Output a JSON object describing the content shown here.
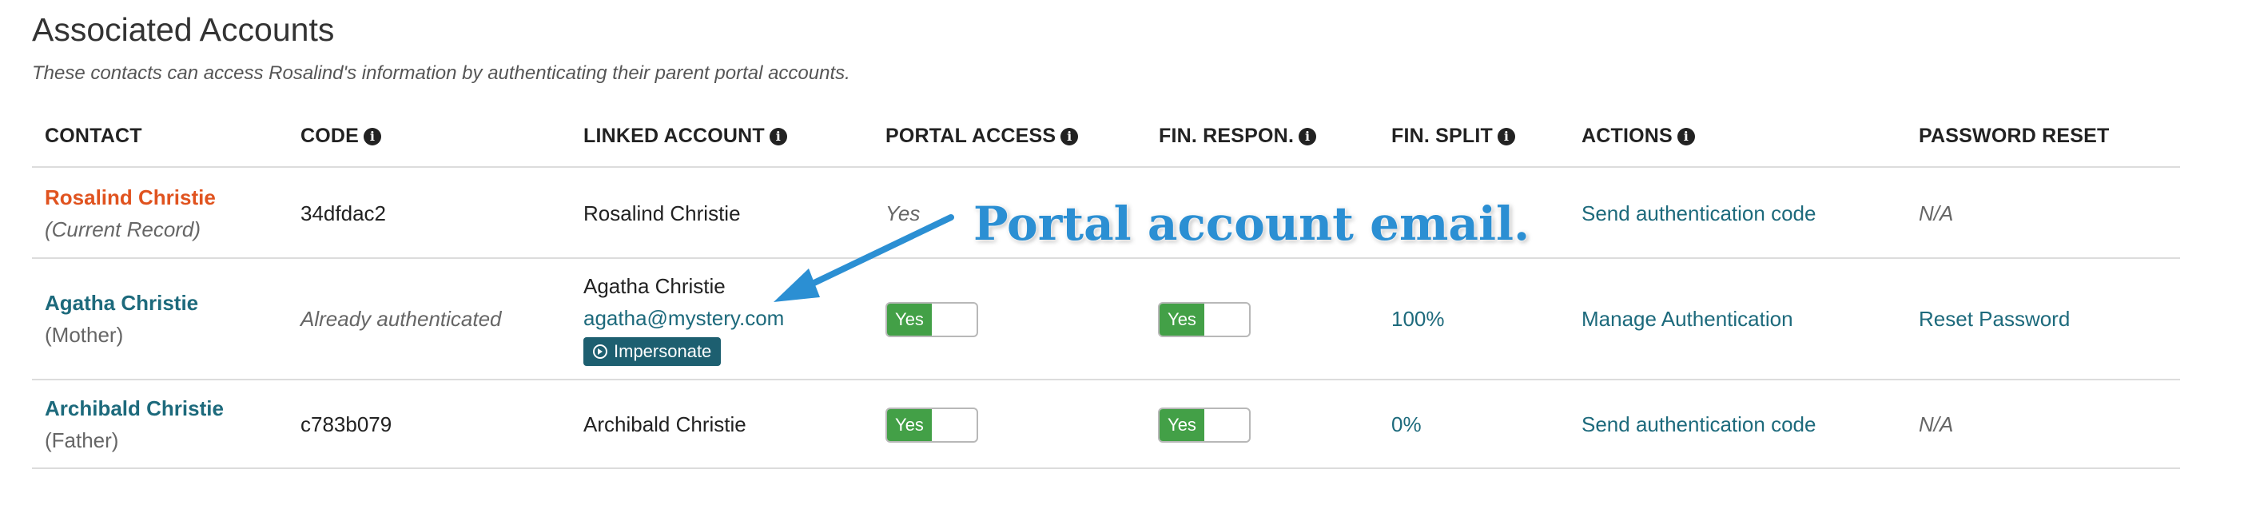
{
  "header": {
    "title": "Associated Accounts",
    "subtitle": "These contacts can access Rosalind's information by authenticating their parent portal accounts."
  },
  "columns": {
    "contact": "CONTACT",
    "code": "CODE",
    "linked_account": "LINKED ACCOUNT",
    "portal_access": "PORTAL ACCESS",
    "fin_respon": "FIN. RESPON.",
    "fin_split": "FIN. SPLIT",
    "actions": "ACTIONS",
    "password_reset": "PASSWORD RESET"
  },
  "rows": [
    {
      "name": "Rosalind Christie",
      "relation": "(Current Record)",
      "code": "34dfdac2",
      "linked_name": "Rosalind Christie",
      "portal_access": "Yes",
      "action": "Send authentication code",
      "password_reset": "N/A"
    },
    {
      "name": "Agatha Christie",
      "relation": "(Mother)",
      "code": "Already authenticated",
      "linked_name": "Agatha Christie",
      "linked_email": "agatha@mystery.com",
      "impersonate": "Impersonate",
      "portal_toggle": "Yes",
      "fin_toggle": "Yes",
      "fin_split": "100%",
      "action": "Manage Authentication",
      "password_reset": "Reset Password"
    },
    {
      "name": "Archibald Christie",
      "relation": "(Father)",
      "code": "c783b079",
      "linked_name": "Archibald Christie",
      "portal_toggle": "Yes",
      "fin_toggle": "Yes",
      "fin_split": "0%",
      "action": "Send authentication code",
      "password_reset": "N/A"
    }
  ],
  "annotation": {
    "text": "Portal account email."
  },
  "colors": {
    "link": "#1d6a7c",
    "current_record": "#e0531f",
    "toggle_on": "#43a047",
    "annotation": "#2b8fd3"
  }
}
